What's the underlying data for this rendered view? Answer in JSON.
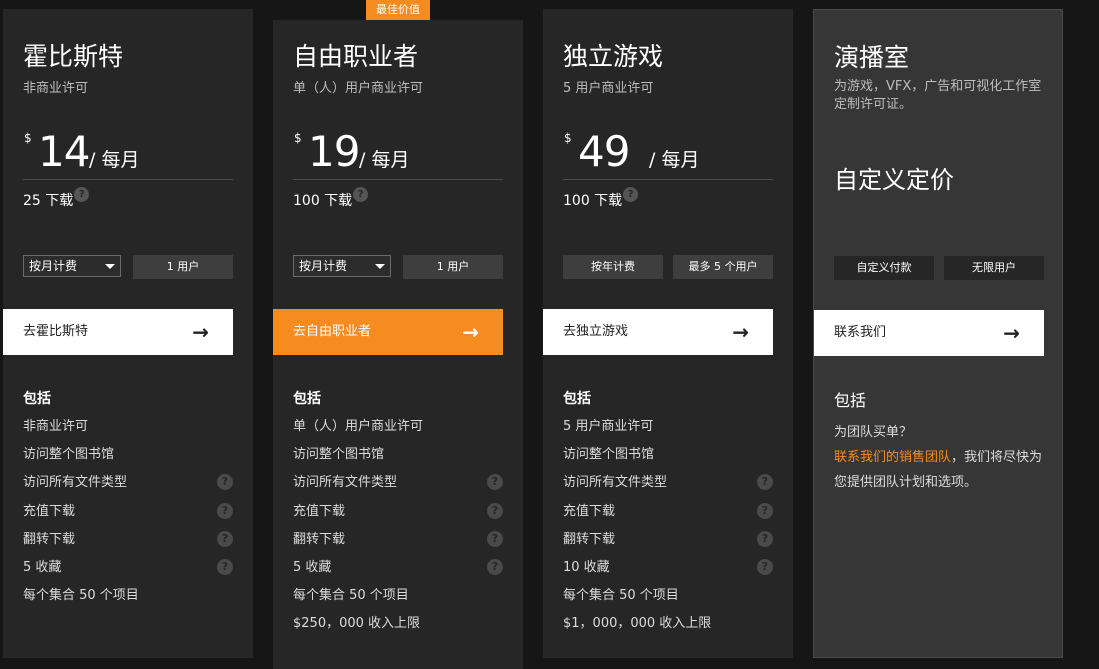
{
  "badge": "最佳价值",
  "includes_label": "包括",
  "plans": [
    {
      "title": "霍比斯特",
      "subtitle": "非商业许可",
      "currency": "$",
      "amount": "14",
      "period": "/ 每月",
      "downloads": "25 下载",
      "billing": "按月计费",
      "users": "1 用户",
      "cta": "去霍比斯特",
      "features": [
        "非商业许可",
        "访问整个图书馆",
        "访问所有文件类型",
        "充值下载",
        "翻转下载",
        "5 收藏",
        "每个集合 50 个项目"
      ]
    },
    {
      "title": "自由职业者",
      "subtitle": "单（人）用户商业许可",
      "currency": "$",
      "amount": "19",
      "period": "/ 每月",
      "downloads": "100 下载",
      "billing": "按月计费",
      "users": "1 用户",
      "cta": "去自由职业者",
      "features": [
        "单（人）用户商业许可",
        "访问整个图书馆",
        "访问所有文件类型",
        "充值下载",
        "翻转下载",
        "5 收藏",
        "每个集合 50 个项目",
        "$250，000 收入上限"
      ]
    },
    {
      "title": "独立游戏",
      "subtitle": "5 用户商业许可",
      "currency": "$",
      "amount": "49",
      "period": "/ 每月",
      "downloads": "100 下载",
      "billing": "按年计费",
      "users": "最多 5 个用户",
      "cta": "去独立游戏",
      "features": [
        "5 用户商业许可",
        "访问整个图书馆",
        "访问所有文件类型",
        "充值下载",
        "翻转下载",
        "10 收藏",
        "每个集合 50 个项目",
        "$1，000，000 收入上限"
      ]
    },
    {
      "title": "演播室",
      "subtitle": "为游戏，VFX，广告和可视化工作室定制许可证。",
      "custom_price": "自定义定价",
      "payment": "自定义付款",
      "users": "无限用户",
      "cta": "联系我们",
      "team_question": "为团队买单？",
      "team_link": "联系我们的销售团队",
      "team_text": "，我们将尽快为您提供团队计划和选项。"
    }
  ],
  "icons": {
    "help": "?",
    "arrow": "→"
  },
  "colors": {
    "accent": "#f68b1f",
    "card": "#262626",
    "studio_card": "#363636"
  }
}
